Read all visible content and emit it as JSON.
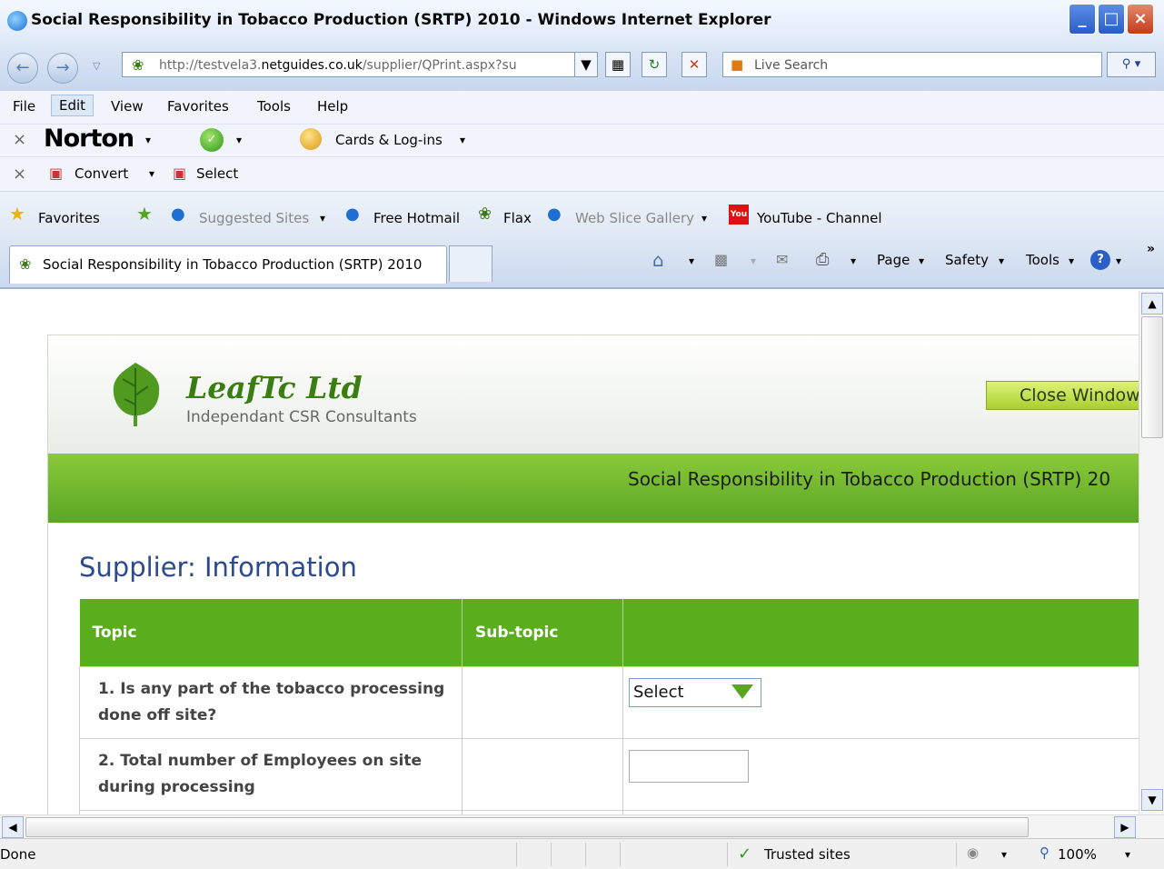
{
  "window": {
    "title": "Social Responsibility in Tobacco Production (SRTP) 2010 - Windows Internet Explorer",
    "minimize": "_",
    "maximize": "□",
    "close": "×"
  },
  "addressbar": {
    "url_prefix": "http://testvela3.",
    "url_domain": "netguides.co.uk",
    "url_path": "/supplier/QPrint.aspx?su",
    "search_placeholder": "Live Search"
  },
  "menubar": {
    "items": [
      "File",
      "Edit",
      "View",
      "Favorites",
      "Tools",
      "Help"
    ]
  },
  "norton": {
    "brand": "Norton",
    "cards": "Cards & Log-ins"
  },
  "convertbar": {
    "convert": "Convert",
    "select": "Select"
  },
  "favorites": {
    "label": "Favorites",
    "items": [
      "Suggested Sites",
      "Free Hotmail",
      "Flax",
      "Web Slice Gallery",
      "YouTube - Channel"
    ]
  },
  "tabs": {
    "active": "Social Responsibility in Tobacco Production (SRTP) 2010",
    "commands": [
      "Page",
      "Safety",
      "Tools"
    ]
  },
  "page": {
    "brand": "LeafTc Ltd",
    "tagline": "Independant CSR Consultants",
    "close_button": "Close Window",
    "banner": "Social Responsibility in Tobacco Production (SRTP) 20",
    "heading": "Supplier: Information",
    "table": {
      "headers": [
        "Topic",
        "Sub-topic",
        ""
      ],
      "rows": [
        {
          "num": "1.",
          "text": "Is any part of the tobacco processing done off site?",
          "control": "Select"
        },
        {
          "num": "2.",
          "text": "Total number of Employees on site during processing",
          "control": ""
        }
      ]
    }
  },
  "status": {
    "text": "Done",
    "zone": "Trusted sites",
    "zoom": "100%"
  }
}
